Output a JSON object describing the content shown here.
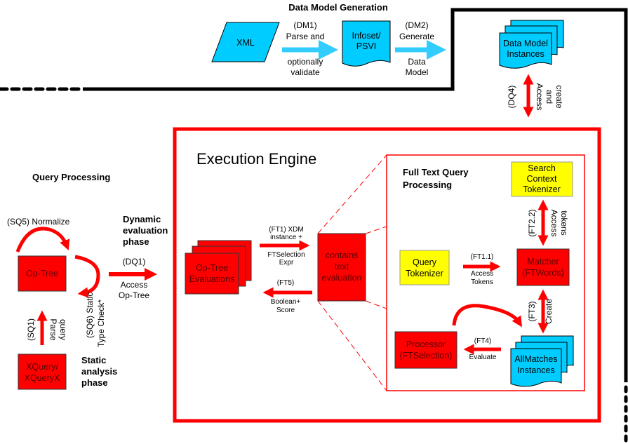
{
  "colors": {
    "red": "#ff0000",
    "cyan": "#00ccff",
    "yellow": "#ffff00",
    "black": "#000000",
    "arrow_red": "#ff0000",
    "arrow_cyan": "#33ccff"
  },
  "data_model_generation": {
    "title": "Data Model Generation",
    "xml": "XML",
    "dm1": {
      "line1": "(DM1)",
      "line2": "Parse and",
      "line3": "optionally",
      "line4": "validate"
    },
    "infoset": {
      "line1": "Infoset/",
      "line2": "PSVI"
    },
    "dm2": {
      "line1": "(DM2)",
      "line2": "Generate",
      "line3": "Data",
      "line4": "Model"
    },
    "instances": {
      "line1": "Data Model",
      "line2": "Instances"
    },
    "dq4": {
      "line1": "(DQ4)",
      "line2": "Access",
      "line3": "and",
      "line4": "create"
    }
  },
  "query_processing": {
    "title": "Query Processing",
    "sq5": "(SQ5) Normalize",
    "op_tree": "Op-Tree",
    "sq6": {
      "line1": "(SQ6) Static",
      "line2": "Type Check*"
    },
    "sq1": {
      "line1": "(SQ1)",
      "line2": "Parse",
      "line3": "query"
    },
    "xquery": {
      "line1": "XQuery/",
      "line2": "XQueryX"
    },
    "static_phase": {
      "line1": "Static",
      "line2": "analysis",
      "line3": "phase"
    },
    "dynamic_phase": {
      "line1": "Dynamic",
      "line2": "evaluation",
      "line3": "phase"
    },
    "dq1": {
      "line1": "(DQ1)",
      "line2": "Access",
      "line3": "Op-Tree"
    }
  },
  "execution_engine": {
    "title": "Execution Engine",
    "op_tree_evaluations": {
      "line1": "Op-Tree",
      "line2": "Evaluations"
    },
    "ft1": {
      "line1": "(FT1) XDM",
      "line2": "instance +",
      "line3": "FTSelection",
      "line4": "Expr"
    },
    "ft5": {
      "line1": "(FT5)",
      "line2": "Boolean+",
      "line3": "Score"
    },
    "contains": {
      "line1": "contains",
      "line2": "text",
      "line3": "evaluation"
    }
  },
  "full_text": {
    "title_line1": "Full Text Query",
    "title_line2": "Processing",
    "search_tokenizer": {
      "line1": "Search",
      "line2": "Context",
      "line3": "Tokenizer"
    },
    "ft22": {
      "line1": "(FT2.2)",
      "line2": "Access",
      "line3": "tokens"
    },
    "query_tokenizer": {
      "line1": "Query",
      "line2": "Tokenizer"
    },
    "ft11": {
      "line1": "(FT1.1)",
      "line2": "Access",
      "line3": "Tokens"
    },
    "matcher": {
      "line1": "Matcher",
      "line2": "(FTWords)"
    },
    "ft3": {
      "line1": "(FT3)",
      "line2": "Create"
    },
    "processor": {
      "line1": "Processor",
      "line2": "(FTSelection)"
    },
    "ft4": {
      "line1": "(FT4)",
      "line2": "Evaluate"
    },
    "allmatches": {
      "line1": "AllMatches",
      "line2": "Instances"
    }
  }
}
